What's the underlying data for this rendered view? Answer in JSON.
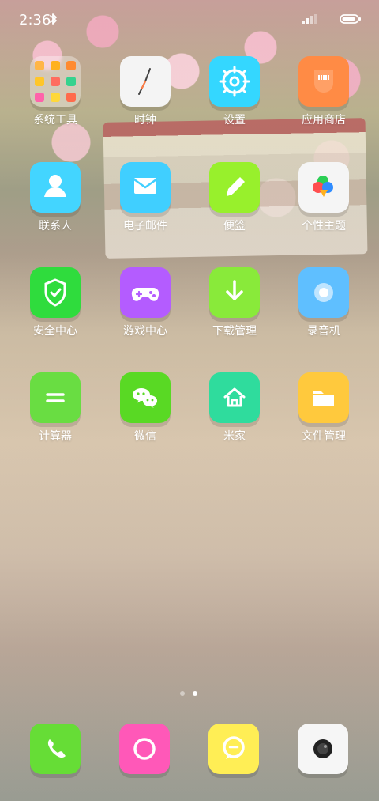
{
  "status_bar": {
    "time": "2:36"
  },
  "home": {
    "apps": [
      {
        "label": "系统工具",
        "icon": "folder-icon"
      },
      {
        "label": "时钟",
        "icon": "clock-icon",
        "color": "#f4f4f4"
      },
      {
        "label": "设置",
        "icon": "settings-icon",
        "color": "#34d7ff"
      },
      {
        "label": "应用商店",
        "icon": "store-icon",
        "color": "#ff8b45"
      },
      {
        "label": "联系人",
        "icon": "contacts-icon",
        "color": "#43d5ff"
      },
      {
        "label": "电子邮件",
        "icon": "email-icon",
        "color": "#40cfff"
      },
      {
        "label": "便签",
        "icon": "notes-icon",
        "color": "#98f02c"
      },
      {
        "label": "个性主题",
        "icon": "theme-icon",
        "color": "#f5f5f5"
      },
      {
        "label": "安全中心",
        "icon": "security-icon",
        "color": "#2fdc3d"
      },
      {
        "label": "游戏中心",
        "icon": "game-icon",
        "color": "#b45cff"
      },
      {
        "label": "下载管理",
        "icon": "download-icon",
        "color": "#89ea3a"
      },
      {
        "label": "录音机",
        "icon": "recorder-icon",
        "color": "#5fbfff"
      },
      {
        "label": "计算器",
        "icon": "calculator-icon",
        "color": "#69dd42"
      },
      {
        "label": "微信",
        "icon": "wechat-icon",
        "color": "#59d924"
      },
      {
        "label": "米家",
        "icon": "mijia-icon",
        "color": "#2fdc9d"
      },
      {
        "label": "文件管理",
        "icon": "file-manager-icon",
        "color": "#ffc93d"
      }
    ],
    "page_indicator": {
      "pages": 2,
      "active": 2
    }
  },
  "dock": [
    {
      "icon": "phone-icon",
      "color": "#66dd36"
    },
    {
      "icon": "browser-icon",
      "color": "#ff58b8"
    },
    {
      "icon": "messages-icon",
      "color": "#ffee55"
    },
    {
      "icon": "camera-icon",
      "color": "#f6f6f6"
    }
  ]
}
